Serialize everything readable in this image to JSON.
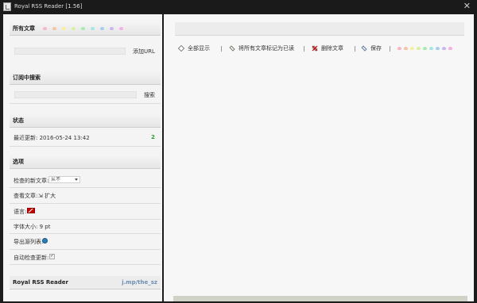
{
  "window": {
    "title": "Royal RSS Reader [1.56]",
    "close_glyph": "✕"
  },
  "all_articles": {
    "heading": "所有文章",
    "dot_colors": [
      "#f7b7c8",
      "#f3c4a6",
      "#f6ef9e",
      "#d7f0a2",
      "#a8ecb2",
      "#a6e6e4",
      "#a8cdef",
      "#c9b6f0",
      "#f1b1e3"
    ],
    "add_url_label": "添加URL",
    "url_value": ""
  },
  "subscription_search": {
    "heading": "订阅中搜索",
    "search_label": "搜索",
    "search_value": ""
  },
  "status": {
    "heading": "状态",
    "last_update": "最近更新: 2016-05-24 13:42",
    "count": "2"
  },
  "options": {
    "heading": "选项",
    "check_new_label": "检查的新文章:",
    "check_new_value": "从不",
    "view_articles_label": "查看文章:",
    "view_articles_value": "扩大",
    "language_label": "语言:",
    "font_size_label": "字体大小: 9 pt",
    "export_list_label": "导出源列表:",
    "auto_check_label": "自动检查更新:"
  },
  "footer": {
    "app_name": "Royal RSS Reader",
    "link": "j.mp/the_sz"
  },
  "toolbar": {
    "show_all": "全部显示",
    "mark_all_read": "将所有文章标记为已读",
    "delete_articles": "删除文章",
    "save": "保存",
    "dot_colors": [
      "#f7b7c8",
      "#f3c4a6",
      "#f6ef9e",
      "#d7f0a2",
      "#a8ecb2",
      "#a6e6e4",
      "#a8cdef",
      "#c9b6f0",
      "#f1b1e3"
    ]
  }
}
